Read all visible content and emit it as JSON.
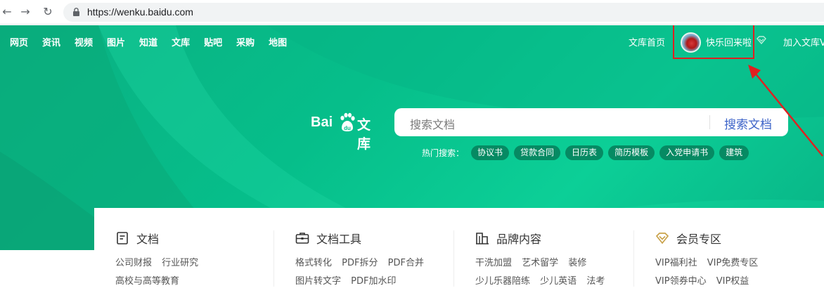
{
  "browser": {
    "url": "https://wenku.baidu.com",
    "back_icon": "arrow-left-icon",
    "forward_icon": "arrow-right-icon",
    "reload_icon": "reload-icon",
    "lock_icon": "lock-icon"
  },
  "topnav": [
    "网页",
    "资讯",
    "视频",
    "图片",
    "知道",
    "文库",
    "贴吧",
    "采购",
    "地图"
  ],
  "header_right": {
    "home_link": "文库首页",
    "username": "快乐回来啦",
    "join_vip": "加入文库V"
  },
  "logo": {
    "bai": "Bai",
    "wenku": "文库"
  },
  "search": {
    "placeholder": "搜索文档",
    "button": "搜索文档"
  },
  "hot": {
    "label": "热门搜索：",
    "tags": [
      "协议书",
      "贷款合同",
      "日历表",
      "简历模板",
      "入党申请书",
      "建筑"
    ]
  },
  "categories": [
    {
      "title": "文档",
      "icon": "document-icon",
      "row1": [
        "公司财报",
        "行业研究"
      ],
      "row2": [
        "高校与高等教育"
      ]
    },
    {
      "title": "文档工具",
      "icon": "toolbox-icon",
      "row1": [
        "格式转化",
        "PDF拆分",
        "PDF合并"
      ],
      "row2": [
        "图片转文字",
        "PDF加水印"
      ]
    },
    {
      "title": "品牌内容",
      "icon": "building-icon",
      "row1": [
        "干洗加盟",
        "艺术留学",
        "装修"
      ],
      "row2": [
        "少儿乐器陪练",
        "少儿英语",
        "法考"
      ]
    },
    {
      "title": "会员专区",
      "icon": "vip-diamond-icon",
      "row1": [
        "VIP福利社",
        "VIP免费专区"
      ],
      "row2": [
        "VIP领券中心",
        "VIP权益"
      ]
    }
  ],
  "colors": {
    "brand_green": "#06be8a",
    "tag_bg": "#068a63",
    "search_button_text": "#3c63c8",
    "annotation_red": "#e02020"
  }
}
